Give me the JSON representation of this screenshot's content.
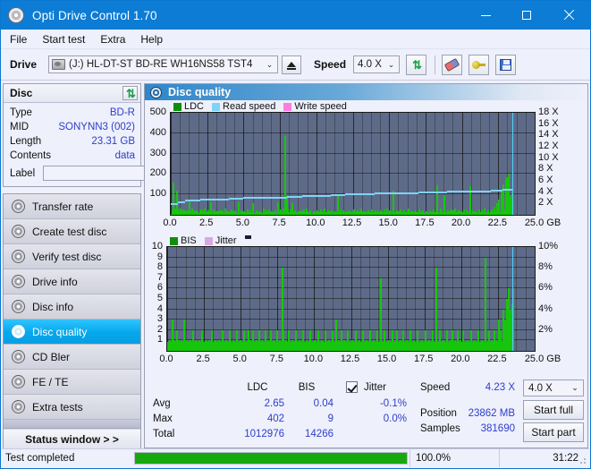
{
  "window": {
    "title": "Opti Drive Control 1.70",
    "icon": "disc-icon",
    "minimize": "–",
    "maximize": "□",
    "close": "✕"
  },
  "menu": {
    "items": [
      "File",
      "Start test",
      "Extra",
      "Help"
    ]
  },
  "toolbar": {
    "drive_label": "Drive",
    "drive_value": "(J:)  HL-DT-ST BD-RE  WH16NS58 TST4",
    "eject_title": "Eject",
    "speed_label": "Speed",
    "speed_value": "4.0 X",
    "refresh_icon": "refresh-icon",
    "erase_icon": "eraser-icon",
    "key_icon": "key-icon",
    "save_icon": "save-icon"
  },
  "disc": {
    "header": "Disc",
    "refresh_icon": "refresh-icon",
    "rows": [
      {
        "key": "Type",
        "value": "BD-R"
      },
      {
        "key": "MID",
        "value": "SONYNN3 (002)"
      },
      {
        "key": "Length",
        "value": "23.31 GB"
      },
      {
        "key": "Contents",
        "value": "data"
      }
    ],
    "label_key": "Label",
    "label_value": "",
    "label_placeholder": "",
    "label_icon": "cd-icon"
  },
  "nav": {
    "items": [
      {
        "label": "Transfer rate",
        "icon": "disc-test-icon",
        "selected": false
      },
      {
        "label": "Create test disc",
        "icon": "disc-write-icon",
        "selected": false
      },
      {
        "label": "Verify test disc",
        "icon": "disc-verify-icon",
        "selected": false
      },
      {
        "label": "Drive info",
        "icon": "disc-drive-icon",
        "selected": false
      },
      {
        "label": "Disc info",
        "icon": "disc-info-icon",
        "selected": false
      },
      {
        "label": "Disc quality",
        "icon": "disc-quality-icon",
        "selected": true
      },
      {
        "label": "CD Bler",
        "icon": "disc-bler-icon",
        "selected": false
      },
      {
        "label": "FE / TE",
        "icon": "disc-fete-icon",
        "selected": false
      },
      {
        "label": "Extra tests",
        "icon": "disc-extra-icon",
        "selected": false
      }
    ],
    "status_button": "Status window > >"
  },
  "panel": {
    "title": "Disc quality",
    "icon": "disc-quality-icon"
  },
  "stats": {
    "columns": [
      "LDC",
      "BIS"
    ],
    "rows": [
      {
        "label": "Avg",
        "ldc": "2.65",
        "bis": "0.04",
        "jitter": "-0.1%"
      },
      {
        "label": "Max",
        "ldc": "402",
        "bis": "9",
        "jitter": "0.0%"
      },
      {
        "label": "Total",
        "ldc": "1012976",
        "bis": "14266",
        "jitter": ""
      }
    ],
    "jitter_label": "Jitter",
    "jitter_checked": true,
    "speed_label": "Speed",
    "speed_value": "4.23 X",
    "position_label": "Position",
    "position_value": "23862 MB",
    "samples_label": "Samples",
    "samples_value": "381690",
    "speed_select": "4.0 X",
    "start_full": "Start full",
    "start_part": "Start part"
  },
  "statusbar": {
    "text": "Test completed",
    "percent_label": "100.0%",
    "percent_value": 100,
    "elapsed": "31:22"
  },
  "colors": {
    "accent": "#0c7cd5",
    "ldc": "#16c60c",
    "bis": "#16c60c",
    "read_speed": "#7fd3f7",
    "write_speed": "#ff7de3",
    "jitter": "#d9a8e0",
    "value_text": "#2d3ecb",
    "plot_bg": "#5e6b88",
    "progress": "#17a80c"
  },
  "chart_data": [
    {
      "type": "bar",
      "title": "LDC / Read speed",
      "xlabel": "GB",
      "ylabel": "LDC",
      "legend": [
        "LDC",
        "Read speed",
        "Write speed"
      ],
      "legend_position": "top-left",
      "grid": true,
      "xlim": [
        0,
        25.0
      ],
      "ylim": [
        0,
        500
      ],
      "xticks": [
        "0.0",
        "2.5",
        "5.0",
        "7.5",
        "10.0",
        "12.5",
        "15.0",
        "17.5",
        "20.0",
        "22.5",
        "25.0 GB"
      ],
      "yticks": [
        "100",
        "200",
        "300",
        "400",
        "500"
      ],
      "y2ticks": [
        "2 X",
        "4 X",
        "6 X",
        "8 X",
        "10 X",
        "12 X",
        "14 X",
        "16 X",
        "18 X"
      ],
      "y2lim": [
        0,
        18
      ],
      "series": [
        {
          "name": "LDC",
          "type": "bar",
          "color": "#16c60c",
          "x": [
            0.05,
            0.15,
            0.25,
            0.35,
            0.45,
            0.5,
            0.6,
            0.7,
            0.8,
            0.9,
            1.0,
            1.1,
            1.25,
            1.4,
            1.5,
            1.65,
            1.8,
            1.95,
            2.1,
            2.3,
            2.5,
            2.7,
            2.9,
            3.1,
            3.3,
            3.5,
            3.7,
            3.9,
            4.1,
            4.35,
            4.6,
            4.8,
            5.0,
            5.2,
            5.4,
            5.6,
            5.85,
            6.1,
            6.3,
            6.5,
            6.7,
            6.9,
            7.1,
            7.3,
            7.5,
            7.65,
            7.8,
            7.9,
            8.0,
            8.15,
            8.3,
            8.5,
            8.7,
            8.9,
            9.1,
            9.3,
            9.5,
            9.75,
            10.0,
            10.25,
            10.5,
            10.75,
            11.0,
            11.2,
            11.4,
            11.6,
            11.8,
            12.0,
            12.25,
            12.5,
            12.75,
            13.0,
            13.25,
            13.5,
            13.75,
            14.0,
            14.2,
            14.4,
            14.6,
            14.8,
            15.0,
            15.25,
            15.5,
            15.6,
            15.75,
            16.0,
            16.25,
            16.5,
            16.75,
            17.0,
            17.25,
            17.5,
            17.75,
            18.0,
            18.25,
            18.5,
            18.75,
            19.0,
            19.1,
            19.25,
            19.35,
            19.5,
            19.7,
            19.9,
            20.1,
            20.3,
            20.5,
            20.7,
            20.9,
            21.1,
            21.3,
            21.5,
            21.75,
            21.9,
            22.0,
            22.2,
            22.35,
            22.5,
            22.65,
            22.8,
            22.95,
            23.05,
            23.15,
            23.25,
            23.35,
            23.45
          ],
          "values": [
            20,
            160,
            30,
            120,
            25,
            18,
            30,
            22,
            25,
            20,
            18,
            22,
            75,
            30,
            22,
            20,
            18,
            25,
            22,
            30,
            20,
            60,
            25,
            18,
            22,
            20,
            30,
            18,
            25,
            20,
            60,
            22,
            18,
            25,
            20,
            55,
            22,
            18,
            30,
            20,
            25,
            18,
            22,
            60,
            25,
            30,
            385,
            90,
            30,
            25,
            55,
            20,
            18,
            22,
            25,
            30,
            20,
            18,
            22,
            25,
            30,
            20,
            22,
            18,
            100,
            25,
            20,
            18,
            22,
            25,
            20,
            30,
            18,
            22,
            25,
            20,
            18,
            22,
            25,
            30,
            20,
            120,
            22,
            18,
            25,
            20,
            30,
            18,
            22,
            25,
            20,
            18,
            22,
            25,
            145,
            30,
            95,
            22,
            18,
            25,
            20,
            30,
            22,
            18,
            25,
            20,
            140,
            22,
            18,
            25,
            20,
            30,
            22,
            18,
            25,
            40,
            55,
            75,
            120,
            150,
            170,
            185,
            200
          ]
        },
        {
          "name": "Read speed",
          "type": "line",
          "color": "#7fd3f7",
          "x": [
            0.0,
            0.5,
            1.0,
            1.5,
            2.0,
            2.5,
            3.0,
            4.0,
            5.0,
            6.0,
            7.0,
            8.0,
            9.0,
            10.0,
            11.0,
            12.0,
            13.0,
            14.0,
            15.0,
            16.0,
            17.0,
            18.0,
            19.0,
            20.0,
            21.0,
            22.0,
            22.8,
            23.4,
            23.45
          ],
          "values": [
            1.8,
            2.0,
            2.3,
            2.3,
            2.5,
            2.6,
            2.6,
            2.7,
            2.8,
            2.9,
            2.9,
            3.0,
            3.1,
            3.2,
            3.3,
            3.4,
            3.5,
            3.6,
            3.7,
            3.7,
            3.8,
            3.85,
            3.9,
            3.95,
            4.0,
            4.1,
            4.2,
            4.2,
            18.0
          ]
        },
        {
          "name": "Write speed",
          "type": "line",
          "color": "#ff7de3",
          "x": [],
          "values": []
        }
      ],
      "cursor_x": 23.45
    },
    {
      "type": "bar",
      "title": "BIS / Jitter",
      "xlabel": "GB",
      "ylabel": "BIS",
      "legend": [
        "BIS",
        "Jitter"
      ],
      "legend_position": "top-left",
      "grid": true,
      "xlim": [
        0,
        25.0
      ],
      "ylim": [
        0,
        10
      ],
      "xticks": [
        "0.0",
        "2.5",
        "5.0",
        "7.5",
        "10.0",
        "12.5",
        "15.0",
        "17.5",
        "20.0",
        "22.5",
        "25.0 GB"
      ],
      "yticks": [
        "1",
        "2",
        "3",
        "4",
        "5",
        "6",
        "7",
        "8",
        "9",
        "10"
      ],
      "y2ticks": [
        "2%",
        "4%",
        "6%",
        "8%",
        "10%"
      ],
      "y2lim": [
        0,
        10
      ],
      "series": [
        {
          "name": "BIS",
          "type": "bar",
          "color": "#16c60c",
          "x": [
            0.1,
            0.3,
            0.45,
            0.6,
            0.75,
            0.9,
            1.1,
            1.3,
            1.5,
            1.7,
            1.9,
            2.1,
            2.3,
            2.55,
            2.8,
            3.0,
            3.2,
            3.45,
            3.7,
            3.95,
            4.2,
            4.45,
            4.7,
            4.95,
            5.2,
            5.45,
            5.6,
            5.8,
            6.0,
            6.2,
            6.4,
            6.6,
            6.8,
            7.0,
            7.2,
            7.4,
            7.6,
            7.8,
            7.85,
            8.0,
            8.2,
            8.45,
            8.7,
            8.95,
            9.2,
            9.45,
            9.7,
            9.95,
            10.2,
            10.45,
            10.7,
            10.95,
            11.2,
            11.45,
            11.6,
            11.8,
            12.0,
            12.25,
            12.5,
            12.75,
            13.0,
            13.25,
            13.5,
            13.75,
            14.0,
            14.25,
            14.5,
            14.75,
            15.0,
            15.25,
            15.5,
            15.6,
            15.8,
            16.0,
            16.25,
            16.5,
            16.75,
            17.0,
            17.25,
            17.5,
            17.75,
            18.0,
            18.25,
            18.5,
            18.75,
            19.0,
            19.2,
            19.35,
            19.5,
            19.7,
            19.9,
            20.1,
            20.35,
            20.6,
            20.85,
            21.1,
            21.35,
            21.6,
            21.85,
            22.0,
            22.2,
            22.35,
            22.5,
            22.65,
            22.8,
            22.95,
            23.05,
            23.15,
            23.25,
            23.35,
            23.45
          ],
          "values": [
            1,
            3,
            1,
            2,
            1,
            1,
            3,
            1,
            1,
            2,
            1,
            1,
            2,
            1,
            1,
            2,
            1,
            1,
            2,
            1,
            2,
            1,
            2,
            1,
            2,
            2,
            1,
            2,
            1,
            2,
            1,
            2,
            1,
            2,
            1,
            2,
            1,
            8,
            2,
            1,
            2,
            1,
            2,
            1,
            2,
            1,
            2,
            1,
            2,
            1,
            2,
            1,
            2,
            3,
            1,
            2,
            1,
            2,
            1,
            2,
            1,
            2,
            1,
            2,
            1,
            2,
            7,
            2,
            1,
            2,
            1,
            2,
            1,
            2,
            1,
            2,
            1,
            2,
            1,
            2,
            1,
            2,
            8,
            2,
            1,
            2,
            1,
            2,
            1,
            2,
            1,
            2,
            1,
            2,
            1,
            2,
            1,
            9,
            2,
            1,
            2,
            1,
            3,
            2,
            4,
            3,
            5,
            6,
            4,
            3,
            6
          ]
        },
        {
          "name": "Jitter",
          "type": "line",
          "color": "#d9a8e0",
          "x": [],
          "values": []
        }
      ],
      "cursor_x": 23.45
    }
  ]
}
